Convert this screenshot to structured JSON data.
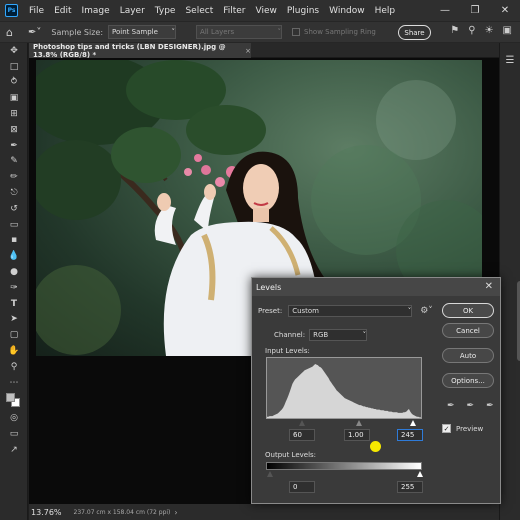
{
  "menubar": {
    "logo": "Ps",
    "items": [
      "File",
      "Edit",
      "Image",
      "Layer",
      "Type",
      "Select",
      "Filter",
      "View",
      "Plugins",
      "Window",
      "Help"
    ]
  },
  "optionsbar": {
    "sample_size_label": "Sample Size:",
    "sample_size_value": "Point Sample",
    "layers_value": "All Layers",
    "show_ring_label": "Show Sampling Ring",
    "share_label": "Share"
  },
  "document": {
    "tab_title": "Photoshop tips and tricks (LBN DESIGNER).jpg @ 13.8% (RGB/8) *",
    "tab_close": "×"
  },
  "status": {
    "zoom": "13.76%",
    "info": "237.07 cm x 158.04 cm (72 ppi)"
  },
  "levels": {
    "title": "Levels",
    "preset_label": "Preset:",
    "preset_value": "Custom",
    "channel_label": "Channel:",
    "channel_value": "RGB",
    "input_label": "Input Levels:",
    "input_black": "60",
    "input_gamma": "1.00",
    "input_white": "245",
    "output_label": "Output Levels:",
    "output_black": "0",
    "output_white": "255",
    "ok_label": "OK",
    "cancel_label": "Cancel",
    "auto_label": "Auto",
    "options_label": "Options...",
    "preview_label": "Preview",
    "preview_checked": true
  },
  "histogram": [
    2,
    2,
    3,
    3,
    3,
    4,
    5,
    6,
    7,
    9,
    11,
    13,
    16,
    20,
    25,
    30,
    35,
    41,
    47,
    53,
    57,
    60,
    62,
    64,
    66,
    68,
    70,
    72,
    74,
    75,
    76,
    77,
    78,
    79,
    80,
    82,
    84,
    83,
    82,
    80,
    79,
    77,
    74,
    71,
    68,
    65,
    62,
    58,
    55,
    52,
    49,
    46,
    43,
    41,
    39,
    37,
    35,
    33,
    31,
    30,
    29,
    28,
    27,
    26,
    25,
    24,
    23,
    22,
    21,
    20,
    20,
    19,
    18,
    18,
    17,
    17,
    16,
    16,
    15,
    15,
    14,
    14,
    13,
    13,
    13,
    12,
    12,
    12,
    11,
    11,
    11,
    10,
    10,
    10,
    9,
    9,
    9,
    9,
    8,
    8,
    8,
    8,
    9,
    9,
    10,
    12,
    14,
    10,
    7,
    5,
    4,
    3,
    2,
    2,
    1,
    1
  ]
}
